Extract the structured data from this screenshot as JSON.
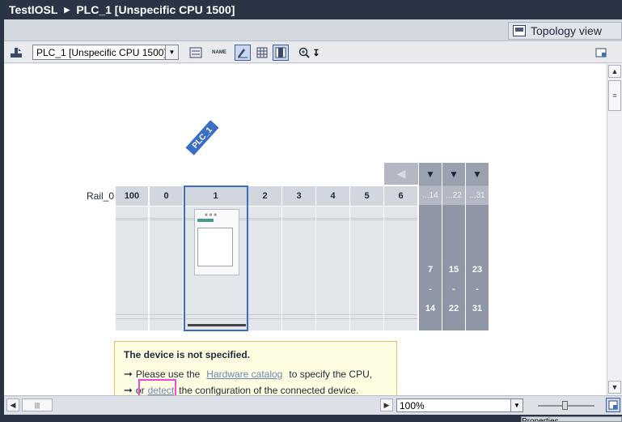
{
  "breadcrumb": {
    "project": "TestIOSL",
    "device": "PLC_1 [Unspecific CPU 1500]"
  },
  "tabs": {
    "topology_view": "Topology view"
  },
  "toolbar": {
    "device_select": "PLC_1 [Unspecific CPU 1500]",
    "name_icon_label": "NAME"
  },
  "rack": {
    "plc_tag": "PLC_1",
    "rail_label": "Rail_0",
    "slots": [
      "100",
      "0",
      "1",
      "2",
      "3",
      "4",
      "5",
      "6"
    ],
    "expansion": [
      {
        "head": "...14",
        "from": "7",
        "dash": "-",
        "to": "14"
      },
      {
        "head": "...22",
        "from": "15",
        "dash": "-",
        "to": "22"
      },
      {
        "head": "...31",
        "from": "23",
        "dash": "-",
        "to": "31"
      }
    ]
  },
  "info": {
    "title": "The device is not specified.",
    "line1_prefix": "Please use the",
    "hardware_catalog_link": "Hardware catalog",
    "line1_suffix": "to specify the CPU,",
    "line2_prefix": "or",
    "detect_link": "detect",
    "line2_suffix": "the configuration of the connected device."
  },
  "bottom": {
    "zoom": "100%",
    "properties_tab": "Properties"
  },
  "colors": {
    "accent": "#3b6fc4",
    "highlight": "#e84bd6",
    "info_bg": "#fffde1"
  }
}
